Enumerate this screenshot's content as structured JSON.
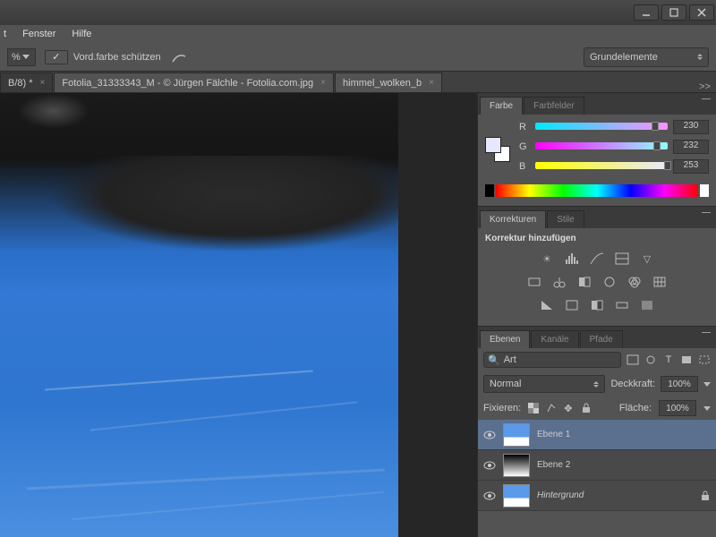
{
  "menu": {
    "fenster": "Fenster",
    "hilfe": "Hilfe"
  },
  "options": {
    "pct": "%",
    "protect": "Vord.farbe schützen",
    "workspace": "Grundelemente"
  },
  "tabs": {
    "t1": "B/8) *",
    "t2": "Fotolia_31333343_M - © Jürgen Fälchle - Fotolia.com.jpg",
    "t3": "himmel_wolken_b",
    "overflow": ">>"
  },
  "panels": {
    "color": {
      "tab1": "Farbe",
      "tab2": "Farbfelder",
      "r": "R",
      "g": "G",
      "b": "B",
      "rv": "230",
      "gv": "232",
      "bv": "253"
    },
    "adjust": {
      "tab1": "Korrekturen",
      "tab2": "Stile",
      "title": "Korrektur hinzufügen"
    },
    "layers": {
      "tab1": "Ebenen",
      "tab2": "Kanäle",
      "tab3": "Pfade",
      "search": "Art",
      "blend": "Normal",
      "opacity_lbl": "Deckkraft:",
      "opacity": "100%",
      "fill_lbl": "Fläche:",
      "fill": "100%",
      "lock_lbl": "Fixieren:",
      "l1": "Ebene 1",
      "l2": "Ebene 2",
      "l3": "Hintergrund"
    }
  }
}
